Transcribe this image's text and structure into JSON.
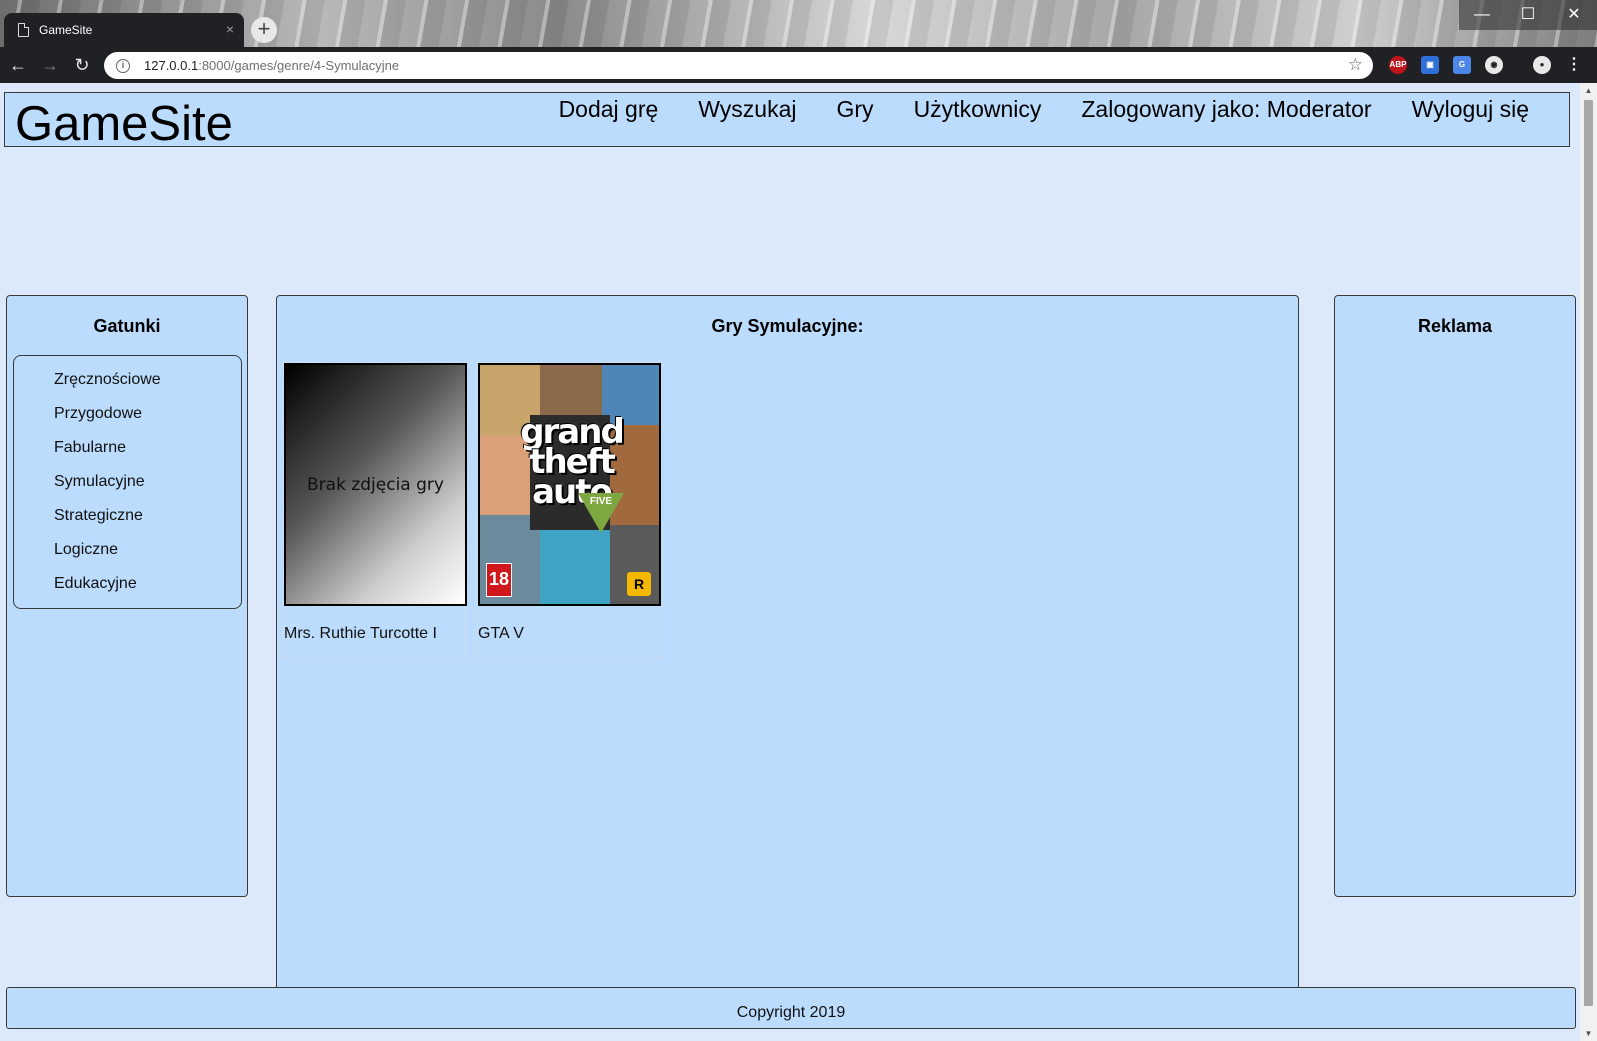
{
  "browser": {
    "tab_title": "GameSite",
    "tab_close": "×",
    "new_tab": "+",
    "window_controls": {
      "minimize": "—",
      "maximize": "☐",
      "close": "✕"
    },
    "url_host": "127.0.0.1",
    "url_path": ":8000/games/genre/4-Symulacyjne",
    "ext_abp": "ABP",
    "icons": [
      "page-icon",
      "back-icon",
      "forward-icon",
      "reload-icon",
      "info-icon",
      "star-icon",
      "adblock-icon",
      "screenshot-icon",
      "translate-icon",
      "circle-extension-icon",
      "profile-icon",
      "menu-icon"
    ]
  },
  "header": {
    "logo": "GameSite",
    "nav": [
      "Dodaj grę",
      "Wyszukaj",
      "Gry",
      "Użytkownicy",
      "Zalogowany jako: Moderator",
      "Wyloguj się"
    ]
  },
  "sidebar": {
    "title": "Gatunki",
    "genres": [
      "Zręcznościowe",
      "Przygodowe",
      "Fabularne",
      "Symulacyjne",
      "Strategiczne",
      "Logiczne",
      "Edukacyjne"
    ]
  },
  "main": {
    "title": "Gry Symulacyjne:",
    "games": [
      {
        "name": "Mrs. Ruthie Turcotte I",
        "placeholder": "Brak zdjęcia gry"
      },
      {
        "name": "GTA V",
        "cover_text": "grand theft auto",
        "cover_five": "FIVE",
        "cover_age": "18",
        "cover_publisher": "R"
      }
    ]
  },
  "ads": {
    "title": "Reklama"
  },
  "footer": {
    "copyright": "Copyright 2019"
  },
  "colors": {
    "page_bg": "#dbe9fb",
    "panel_bg": "#bbdcfd",
    "border": "#3a3a3a",
    "chrome_dark": "#202124"
  }
}
